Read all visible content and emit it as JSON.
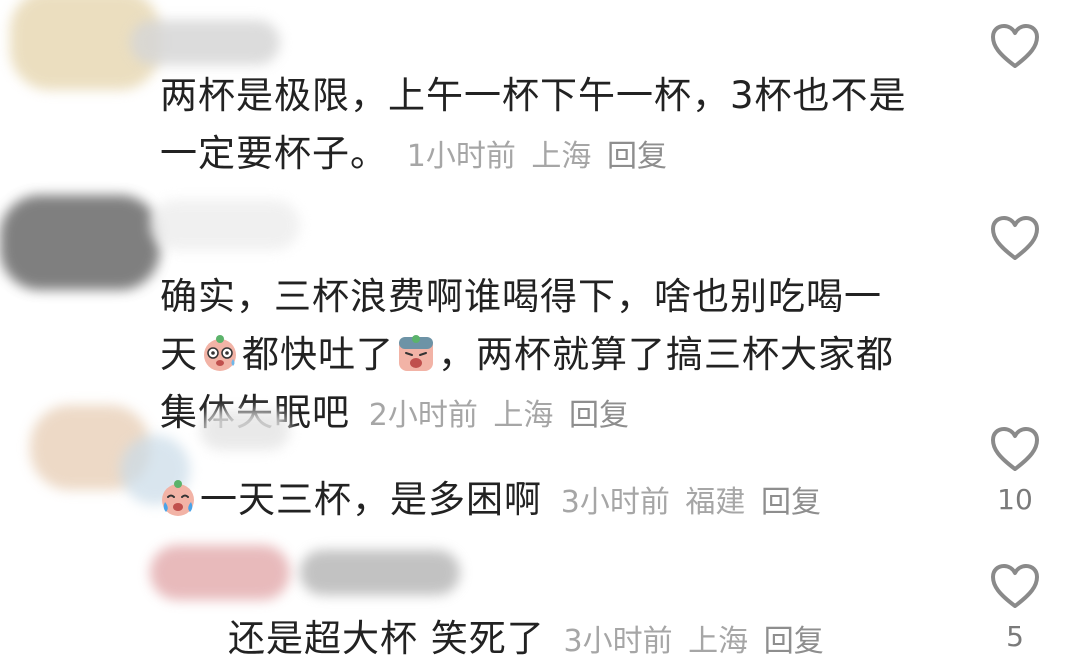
{
  "comments": [
    {
      "text_line1": "两杯是极限，上午一杯下午一杯，3杯也不是",
      "text_line2": "一定要杯子。",
      "time": "1小时前",
      "location": "上海",
      "reply": "回复",
      "likes": ""
    },
    {
      "text_line1": "确实，三杯浪费啊谁喝得下，啥也别吃喝一",
      "text_line2a": "天",
      "text_line2b": "都快吐了",
      "text_line2c": "，两杯就算了搞三杯大家都",
      "text_line3": "集体失眠吧",
      "time": "2小时前",
      "location": "上海",
      "reply": "回复",
      "likes": ""
    },
    {
      "text": "一天三杯，是多困啊",
      "time": "3小时前",
      "location": "福建",
      "reply": "回复",
      "likes": "10"
    },
    {
      "text": "还是超大杯 笑死了",
      "time": "3小时前",
      "location": "上海",
      "reply": "回复",
      "likes": "5"
    }
  ],
  "icons": {
    "like": "heart-outline-icon",
    "emoji_dizzy": "dizzy-face-emoji",
    "emoji_sick": "nauseated-face-emoji",
    "emoji_crying": "crying-face-emoji"
  },
  "colors": {
    "text": "#222222",
    "meta": "#a6a6a6",
    "heart": "#8a8a8a"
  }
}
